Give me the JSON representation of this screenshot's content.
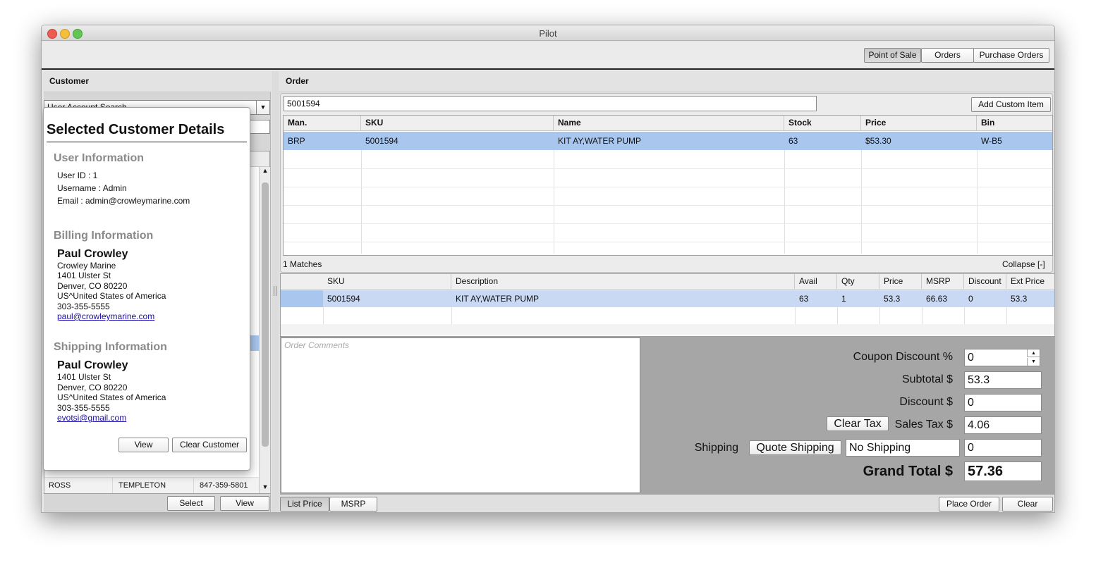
{
  "window": {
    "title": "Pilot"
  },
  "nav": {
    "point_of_sale": "Point of Sale",
    "orders": "Orders",
    "purchase_orders": "Purchase Orders"
  },
  "customer_panel": {
    "title": "Customer",
    "search_mode": "User Account Search",
    "visible_row": {
      "first": "ROSS",
      "last": "TEMPLETON",
      "phone": "847-359-5801"
    },
    "select_label": "Select",
    "view_label": "View"
  },
  "popup": {
    "title": "Selected Customer Details",
    "user_info": {
      "heading": "User Information",
      "user_id": "User ID : 1",
      "username": "Username : Admin",
      "email": "Email : admin@crowleymarine.com"
    },
    "billing": {
      "heading": "Billing Information",
      "name": "Paul Crowley",
      "company": "Crowley Marine",
      "street": "1401 Ulster St",
      "city": "Denver, CO 80220",
      "country": "US^United States of America",
      "phone": "303-355-5555",
      "email": "paul@crowleymarine.com"
    },
    "shipping": {
      "heading": "Shipping Information",
      "name": "Paul Crowley",
      "street": "1401 Ulster St",
      "city": "Denver, CO 80220",
      "country": "US^United States of America",
      "phone": "303-355-5555",
      "email": "evotsi@gmail.com"
    },
    "view_label": "View",
    "clear_label": "Clear Customer"
  },
  "order": {
    "title": "Order",
    "search_value": "5001594",
    "add_custom_label": "Add Custom Item",
    "results_headers": [
      "Man.",
      "SKU",
      "Name",
      "Stock",
      "Price",
      "Bin"
    ],
    "results_rows": [
      [
        "BRP",
        "5001594",
        "KIT AY,WATER PUMP",
        "63",
        "$53.30",
        "W-B5"
      ]
    ],
    "matches": "1 Matches",
    "collapse": "Collapse [-]",
    "line_headers": [
      "",
      "SKU",
      "Description",
      "Avail",
      "Qty",
      "Price",
      "MSRP",
      "Discount",
      "Ext Price"
    ],
    "line_rows": [
      [
        "",
        "5001594",
        "KIT AY,WATER PUMP",
        "63",
        "1",
        "53.3",
        "66.63",
        "0",
        "53.3"
      ]
    ],
    "comments_placeholder": "Order Comments"
  },
  "totals": {
    "coupon_label": "Coupon Discount %",
    "coupon_value": "0",
    "subtotal_label": "Subtotal $",
    "subtotal_value": "53.3",
    "discount_label": "Discount $",
    "discount_value": "0",
    "clear_tax_label": "Clear Tax",
    "sales_tax_label": "Sales Tax $",
    "sales_tax_value": "4.06",
    "shipping_label": "Shipping",
    "quote_shipping_label": "Quote Shipping",
    "shipping_method": "No Shipping",
    "shipping_value": "0",
    "grand_total_label": "Grand Total $",
    "grand_total_value": "57.36"
  },
  "footer": {
    "list_price": "List Price",
    "msrp": "MSRP",
    "place_order": "Place Order",
    "clear": "Clear"
  },
  "colors": {
    "selected_row": "#a9c6ee",
    "line_row": "#c9d9f3",
    "totals_bg": "#a6a6a6"
  }
}
